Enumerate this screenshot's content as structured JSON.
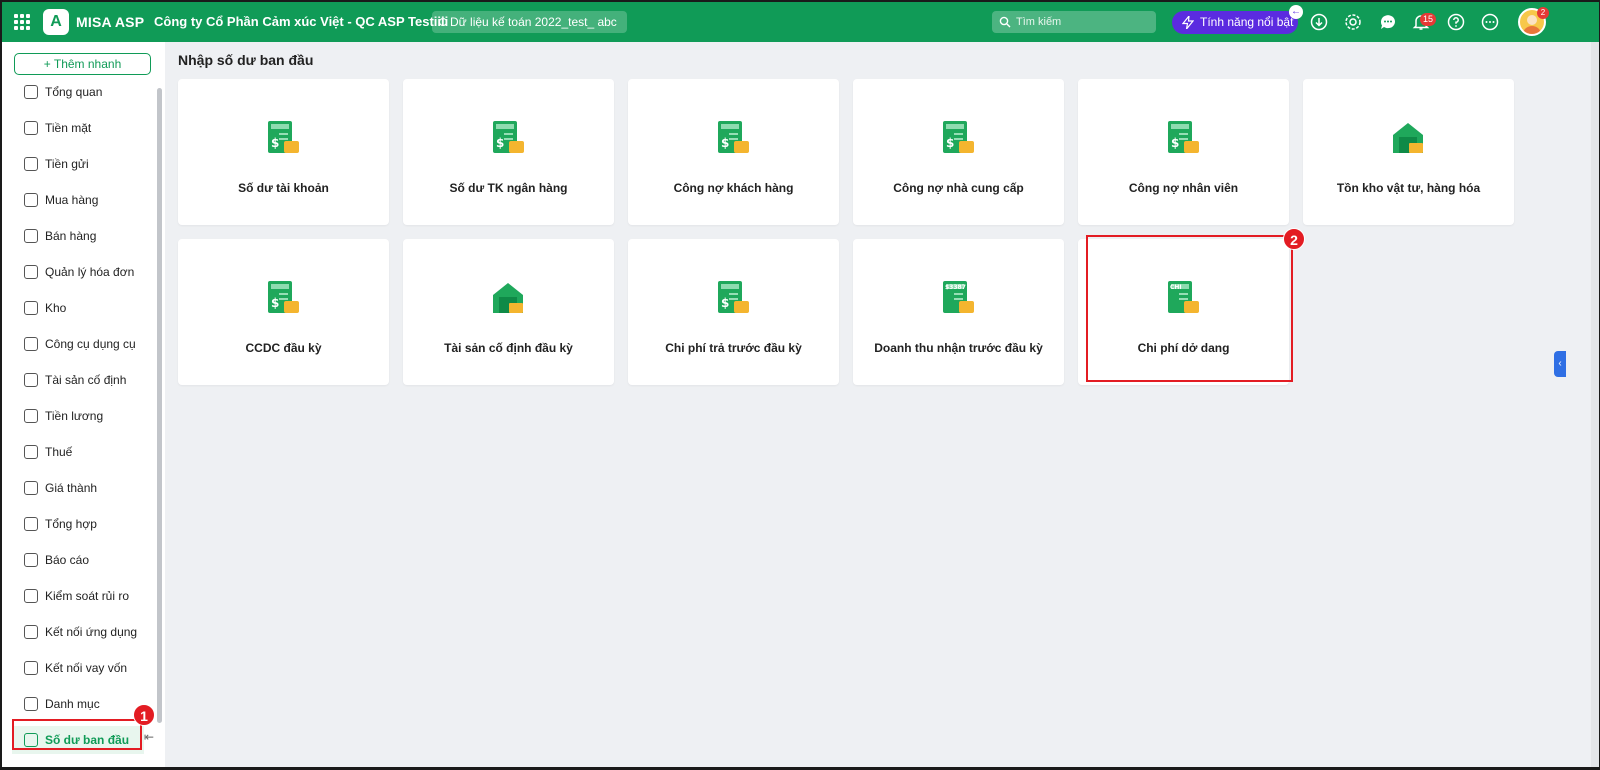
{
  "header": {
    "app_name": "MISA ASP",
    "logo_letter": "A",
    "company": "Công ty Cổ Phần Cảm xúc Việt - QC ASP Testiiii",
    "database": "Dữ liệu kế toán 2022_test_ abc",
    "search_placeholder": "Tìm kiếm",
    "feature_button": "Tính năng nổi bật",
    "notification_count": "15",
    "avatar_badge": "2",
    "brand_color": "#109b57",
    "feature_color": "#5b2be0"
  },
  "sidebar": {
    "quick_add": "Thêm nhanh",
    "items": [
      {
        "label": "Tổng quan",
        "icon": "dashboard-icon"
      },
      {
        "label": "Tiền mặt",
        "icon": "cash-icon"
      },
      {
        "label": "Tiền gửi",
        "icon": "bank-icon"
      },
      {
        "label": "Mua hàng",
        "icon": "shopping-bag-icon"
      },
      {
        "label": "Bán hàng",
        "icon": "cart-icon"
      },
      {
        "label": "Quản lý hóa đơn",
        "icon": "invoice-icon"
      },
      {
        "label": "Kho",
        "icon": "warehouse-icon"
      },
      {
        "label": "Công cụ dụng cụ",
        "icon": "tools-icon"
      },
      {
        "label": "Tài sản cố định",
        "icon": "truck-icon"
      },
      {
        "label": "Tiền lương",
        "icon": "salary-icon"
      },
      {
        "label": "Thuế",
        "icon": "tax-icon"
      },
      {
        "label": "Giá thành",
        "icon": "price-icon"
      },
      {
        "label": "Tổng hợp",
        "icon": "summary-icon"
      },
      {
        "label": "Báo cáo",
        "icon": "report-icon"
      },
      {
        "label": "Kiểm soát rủi ro",
        "icon": "risk-icon"
      },
      {
        "label": "Kết nối ứng dụng",
        "icon": "plug-icon"
      },
      {
        "label": "Kết nối vay vốn",
        "icon": "globe-icon"
      },
      {
        "label": "Danh mục",
        "icon": "list-icon"
      },
      {
        "label": "Số dư ban đầu",
        "icon": "opening-balance-icon"
      }
    ]
  },
  "main": {
    "title": "Nhập số dư ban đầu",
    "cards": [
      {
        "label": "Số dư tài khoản",
        "icon": "account-balance-icon"
      },
      {
        "label": "Số dư TK ngân hàng",
        "icon": "bank-balance-icon"
      },
      {
        "label": "Công nợ khách hàng",
        "icon": "customer-debt-icon"
      },
      {
        "label": "Công nợ nhà cung cấp",
        "icon": "supplier-debt-icon"
      },
      {
        "label": "Công nợ nhân viên",
        "icon": "employee-debt-icon"
      },
      {
        "label": "Tồn kho vật tư, hàng hóa",
        "icon": "inventory-icon"
      },
      {
        "label": "CCDC đầu kỳ",
        "icon": "tools-opening-icon"
      },
      {
        "label": "Tài sản cố định đầu kỳ",
        "icon": "fixed-asset-icon"
      },
      {
        "label": "Chi phí trả trước đầu kỳ",
        "icon": "prepaid-expense-icon"
      },
      {
        "label": "Doanh thu nhận trước đầu kỳ",
        "icon": "unearned-revenue-icon",
        "icon_text": "$3387"
      },
      {
        "label": "Chi phí dở dang",
        "icon": "wip-cost-icon",
        "icon_text": "CHI"
      }
    ]
  },
  "annotations": {
    "step1": "1",
    "step2": "2",
    "highlight_color": "#e31c23"
  }
}
